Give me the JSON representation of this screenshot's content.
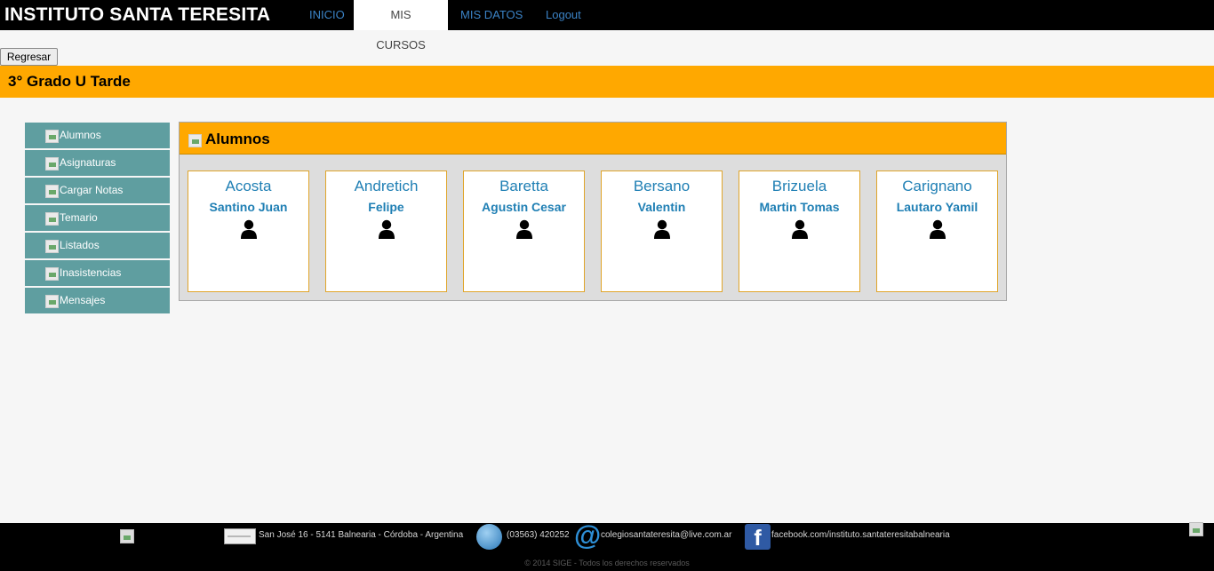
{
  "header": {
    "brand": "INSTITUTO SANTA TERESITA",
    "nav": [
      {
        "label": "INICIO",
        "active": false
      },
      {
        "label": "MIS CURSOS",
        "active": true
      },
      {
        "label": "MIS DATOS",
        "active": false
      },
      {
        "label": "Logout",
        "active": false
      }
    ]
  },
  "back_button": "Regresar",
  "course_title": "3° Grado U Tarde",
  "sidebar": {
    "items": [
      {
        "label": "Alumnos"
      },
      {
        "label": "Asignaturas"
      },
      {
        "label": "Cargar Notas"
      },
      {
        "label": "Temario"
      },
      {
        "label": "Listados"
      },
      {
        "label": "Inasistencias"
      },
      {
        "label": "Mensajes"
      }
    ]
  },
  "panel": {
    "title": "Alumnos",
    "students": [
      {
        "apellido": "Acosta",
        "nombre": "Santino Juan"
      },
      {
        "apellido": "Andretich",
        "nombre": "Felipe"
      },
      {
        "apellido": "Baretta",
        "nombre": "Agustin Cesar"
      },
      {
        "apellido": "Bersano",
        "nombre": "Valentin"
      },
      {
        "apellido": "Brizuela",
        "nombre": "Martin Tomas"
      },
      {
        "apellido": "Carignano",
        "nombre": "Lautaro Yamil"
      }
    ]
  },
  "footer": {
    "address": "San José 16 - 5141 Balnearia - Córdoba - Argentina",
    "phone": "(03563) 420252",
    "email": "colegiosantateresita@live.com.ar",
    "facebook": "facebook.com/instituto.santateresitabalnearia",
    "copyright": "© 2014 SIGE - Todos los derechos reservados"
  },
  "colors": {
    "accent_orange": "#ffa800",
    "sidebar_teal": "#5f9ea0",
    "link_blue": "#1f7fb4"
  }
}
